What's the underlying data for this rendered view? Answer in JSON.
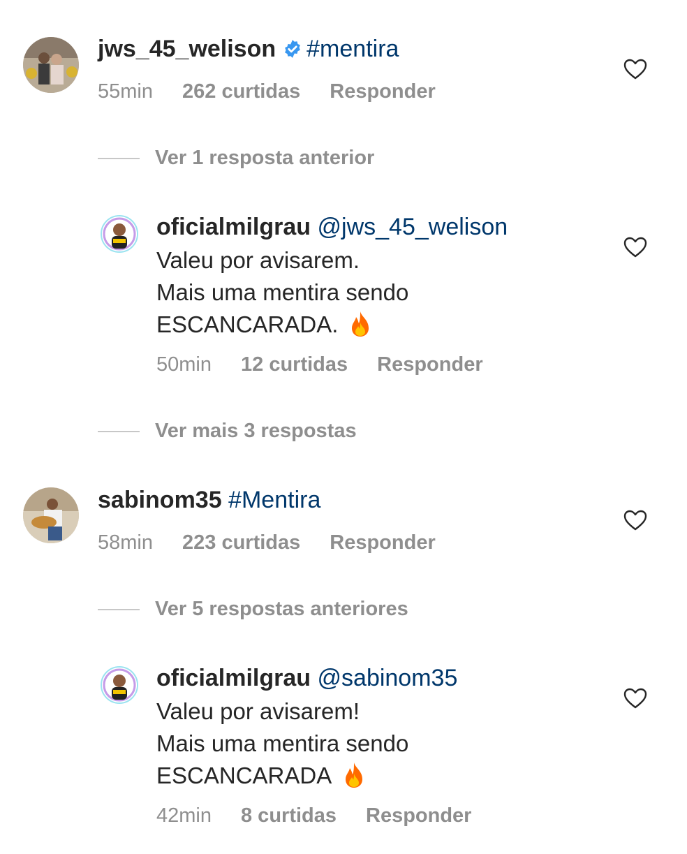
{
  "comments": [
    {
      "username": "jws_45_welison",
      "verified": true,
      "text": "#mentira",
      "time": "55min",
      "likes": "262 curtidas",
      "reply_label": "Responder"
    },
    {
      "username": "oficialmilgrau",
      "mention": "@jws_45_welison",
      "lines": [
        "Valeu por avisarem.",
        "Mais uma mentira sendo",
        "ESCANCARADA."
      ],
      "time": "50min",
      "likes": "12 curtidas",
      "reply_label": "Responder"
    },
    {
      "username": "sabinom35",
      "text": "#Mentira",
      "time": "58min",
      "likes": "223 curtidas",
      "reply_label": "Responder"
    },
    {
      "username": "oficialmilgrau",
      "mention": "@sabinom35",
      "lines": [
        "Valeu por avisarem!",
        "Mais uma mentira sendo",
        "ESCANCARADA"
      ],
      "time": "42min",
      "likes": "8 curtidas",
      "reply_label": "Responder"
    }
  ],
  "toggles": {
    "t1": "Ver 1 resposta anterior",
    "t2": "Ver mais 3 respostas",
    "t3": "Ver 5 respostas anteriores"
  },
  "colors": {
    "hashtag": "#00376b",
    "meta": "#8e8e8e",
    "verified": "#3897f0",
    "fire": "#ff6a00"
  },
  "icons": [
    "heart-icon",
    "verified-badge-icon",
    "fire-emoji-icon"
  ]
}
